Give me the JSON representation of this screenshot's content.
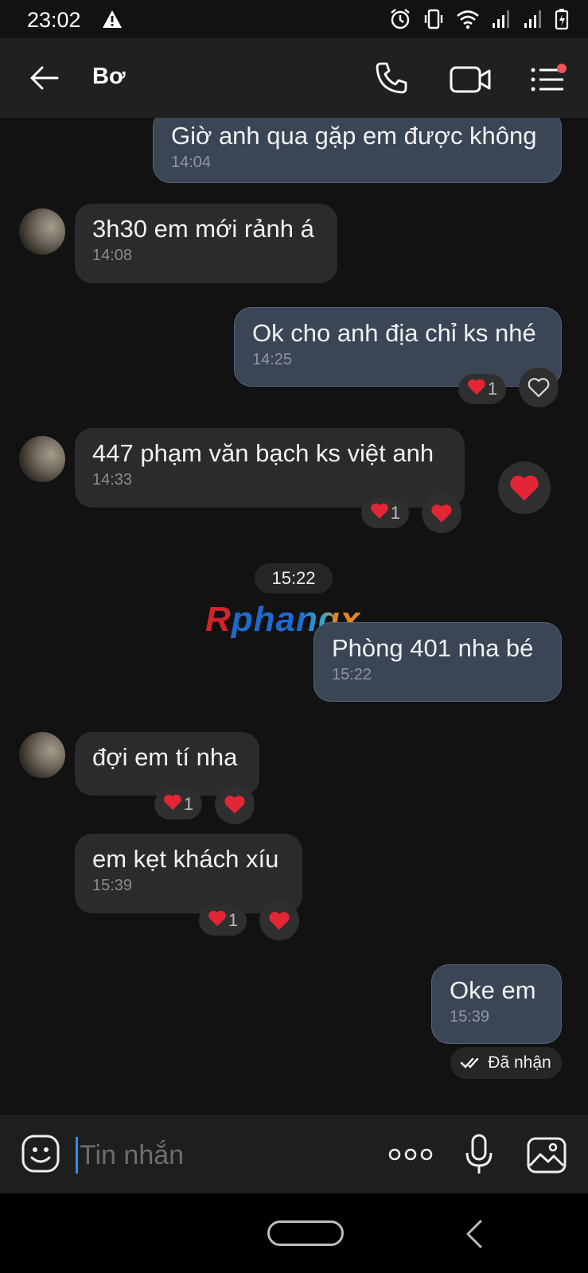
{
  "status_bar": {
    "time": "23:02"
  },
  "header": {
    "contact_name": "Bơ"
  },
  "messages": [
    {
      "text": "Giờ anh qua gặp em được không",
      "time": "14:04"
    },
    {
      "text": "3h30 em mới rảnh á",
      "time": "14:08"
    },
    {
      "text": "Ok cho anh địa chỉ ks nhé",
      "time": "14:25",
      "reaction_count": "1"
    },
    {
      "text": "447 phạm văn bạch ks việt anh",
      "time": "14:33",
      "reaction_count": "1"
    },
    {
      "text": "Phòng 401 nha bé",
      "time": "15:22"
    },
    {
      "text": "đợi em tí nha",
      "time": "",
      "reaction_count": "1"
    },
    {
      "text": "em kẹt khách xíu",
      "time": "15:39",
      "reaction_count": "1"
    },
    {
      "text": "Oke em",
      "time": "15:39"
    }
  ],
  "date_separator": "15:22",
  "watermark": "Rphangx",
  "delivery_status": "Đã nhận",
  "composer": {
    "placeholder": "Tin nhắn"
  },
  "colors": {
    "outgoing_bubble": "#3a4556",
    "incoming_bubble": "#2b2b2b",
    "heart": "#e32636",
    "caret": "#2d8cff"
  }
}
